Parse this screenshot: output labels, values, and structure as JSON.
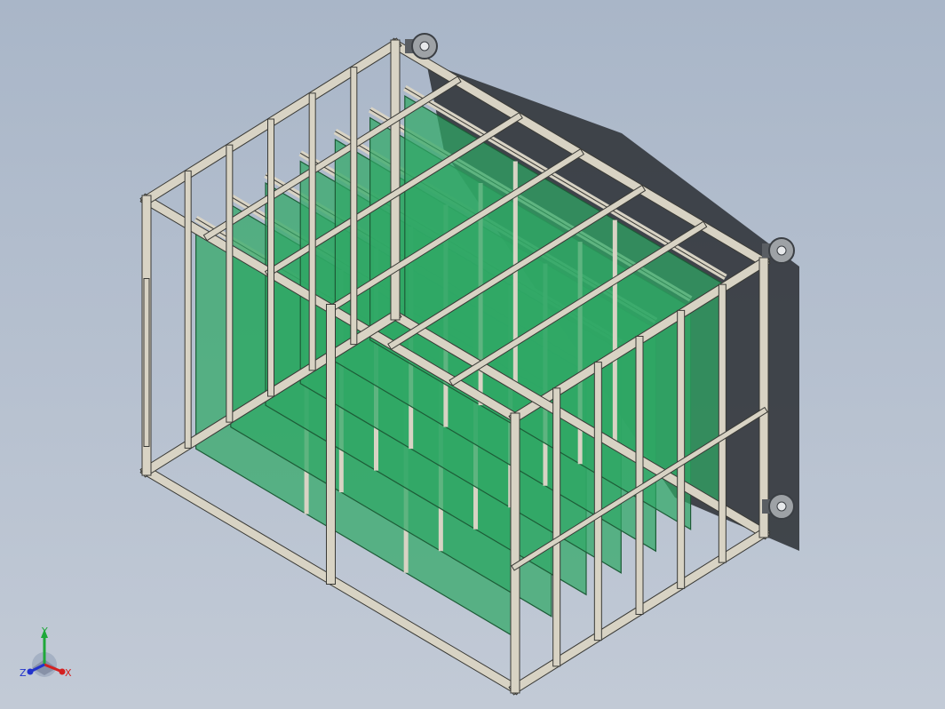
{
  "viewport": {
    "background_top": "#a9b6c8",
    "background_bottom": "#c2cad6"
  },
  "model": {
    "frame_color": "#d8d3c4",
    "frame_edge_color": "#3a3a36",
    "panel_color": "#2fa865",
    "panel_edge_color": "#1d5c37",
    "shadow_color": "#2a2e33",
    "caster_color": "#9ea2a6",
    "panel_count": 7
  },
  "triad": {
    "x_label": "X",
    "y_label": "Y",
    "z_label": "Z",
    "x_color": "#d42020",
    "y_color": "#1fa83a",
    "z_color": "#2233cc"
  }
}
